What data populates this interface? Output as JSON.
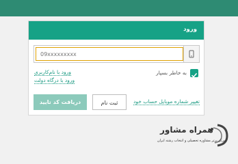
{
  "card": {
    "title": "ورود",
    "phone_input": {
      "placeholder": "09xxxxxxxxx",
      "value": ""
    },
    "remember_label": "به خاطر بسپار",
    "remember_checked": true,
    "link_username": "ورود با نام‌کاربری",
    "link_gov": "ورود با درگاه دولت",
    "link_change_mobile": "تغییر شماره موبایل حساب خود",
    "register_label": "ثبت نام",
    "confirm_label": "دریافت کد تایید"
  },
  "logo": {
    "name": "همراه مشاور",
    "tagline": "مرکز برتر مشاوره تحصیلی و انتخاب رشته ایران"
  },
  "colors": {
    "header": "#16a286",
    "topbar": "#2e8b73",
    "confirm": "#8ccabb",
    "focus": "#e0a100"
  }
}
